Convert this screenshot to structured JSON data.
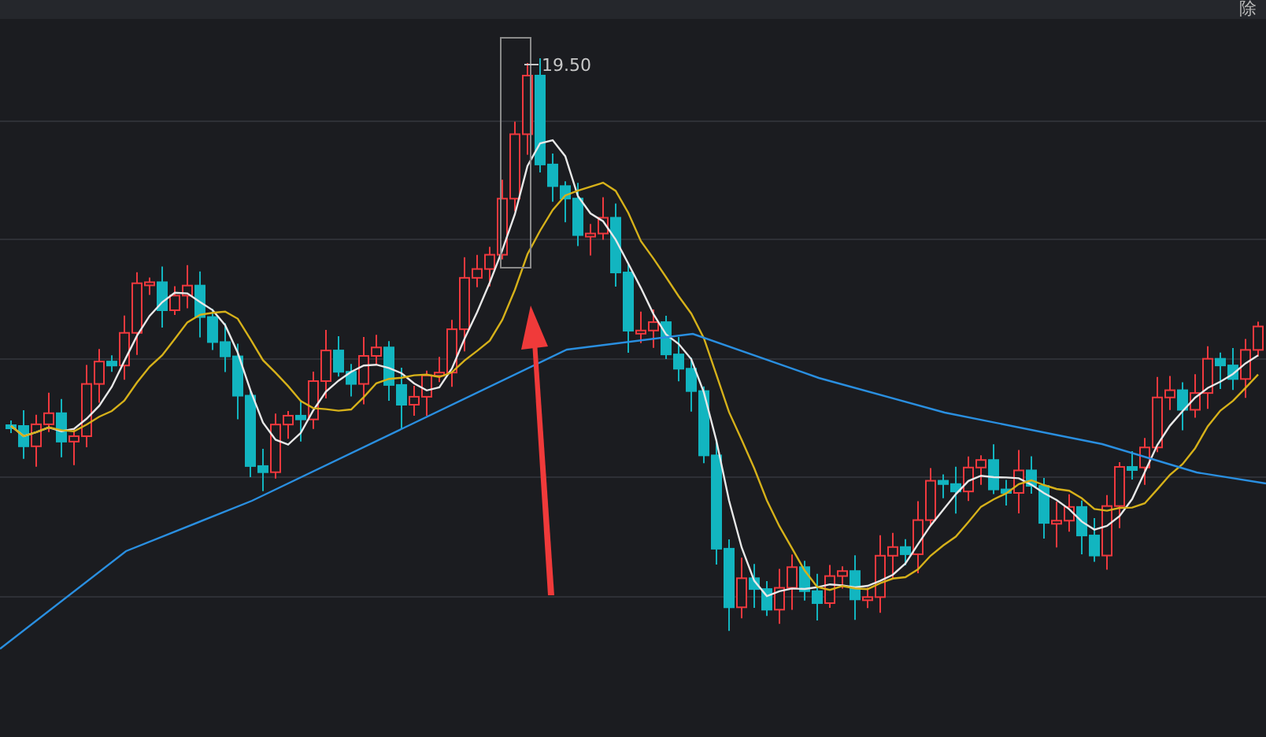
{
  "header": {
    "label": "除"
  },
  "chart": {
    "high_label": "19.50"
  }
}
